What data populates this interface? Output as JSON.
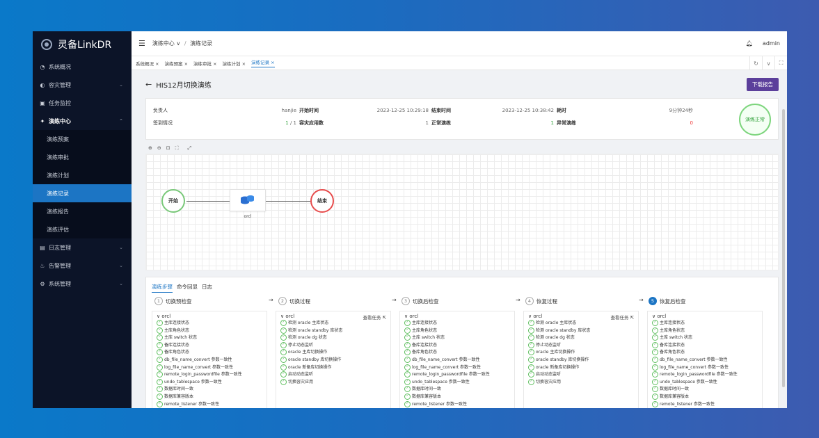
{
  "app": {
    "name": "灵备LinkDR"
  },
  "sidebar": {
    "items": [
      {
        "icon": "◔",
        "label": "系统概况",
        "open": false
      },
      {
        "icon": "◐",
        "label": "容灾管理",
        "open": false,
        "arrow": "⌄"
      },
      {
        "icon": "▣",
        "label": "任务监控",
        "open": false
      }
    ],
    "drill": {
      "icon": "✦",
      "label": "演练中心",
      "arrow": "⌃"
    },
    "sub_items": [
      "演练预案",
      "演练审批",
      "演练计划",
      "演练记录",
      "演练报告",
      "演练评估"
    ],
    "active_sub": "演练记录",
    "items_after": [
      {
        "icon": "▤",
        "label": "日志管理",
        "arrow": "⌄"
      },
      {
        "icon": "♨",
        "label": "告警管理",
        "arrow": "⌄"
      },
      {
        "icon": "⚙",
        "label": "系统管理",
        "arrow": "⌄"
      }
    ]
  },
  "topbar": {
    "breadcrumb_parent": "演练中心",
    "breadcrumb_current": "演练记录",
    "user": "admin"
  },
  "tabs": [
    {
      "label": "系统概况 ×"
    },
    {
      "label": "演练预案 ×"
    },
    {
      "label": "演练审批 ×"
    },
    {
      "label": "演练计划 ×"
    },
    {
      "label": "演练记录 ×",
      "active": true
    }
  ],
  "page": {
    "title": "HIS12月切换演练",
    "report_button": "下载报告"
  },
  "info": {
    "owner_label": "负责人",
    "owner": "hanjie",
    "start_label": "开始时间",
    "start": "2023-12-25 10:29:18",
    "end_label": "结束时间",
    "end": "2023-12-25 10:38:42",
    "duration_label": "耗时",
    "duration": "9分钟24秒",
    "signin_label": "签到情况",
    "signin_a": "1",
    "signin_b": " / 1",
    "apps_label": "容灾应用数",
    "apps": "1",
    "normal_label": "正常演练",
    "normal": "1",
    "abnormal_label": "异常演练",
    "abnormal": "0",
    "status": "演练正常"
  },
  "flow": {
    "start": "开始",
    "end": "结束",
    "db_node": "orcl"
  },
  "panel": {
    "tabs": [
      "演练步骤",
      "命令回显",
      "日志"
    ],
    "steps": [
      {
        "num": "1",
        "label": "切换预检查"
      },
      {
        "num": "2",
        "label": "切换过程"
      },
      {
        "num": "3",
        "label": "切换后检查"
      },
      {
        "num": "4",
        "label": "恢复过程"
      },
      {
        "num": "5",
        "label": "恢复后检查"
      }
    ],
    "db": "∨ orcl",
    "view_task": "查看任务 ⇱",
    "check_list": [
      "主库连接状态",
      "主库角色状态",
      "主库 switch 状态",
      "备库连接状态",
      "备库角色状态",
      "db_file_name_convert 参数一致性",
      "log_file_name_convert 参数一致性",
      "remote_login_passwordfile 参数一致性",
      "undo_tablespace 参数一致性",
      "数据库时间一致",
      "数据库兼容版本",
      "remote_listener 参数一致性"
    ],
    "switch_list": [
      "检测 oracle 主库状态",
      "检测 oracle standby 库状态",
      "检测 oracle dg 状态",
      "停止动态监听",
      "oracle 主库切换操作",
      "oracle standby 库切换操作",
      "oracle 新备库切换操作",
      "启动动态监听",
      "切换容灾应用"
    ],
    "restore_list": [
      "检测 oracle 主库状态",
      "检测 oracle standby 库状态",
      "检测 oracle dg 状态",
      "停止动态监听",
      "oracle 主库切换操作",
      "oracle standby 库切换操作",
      "oracle 新备库切换操作",
      "启动动态监听",
      "切换容灾应用"
    ]
  }
}
